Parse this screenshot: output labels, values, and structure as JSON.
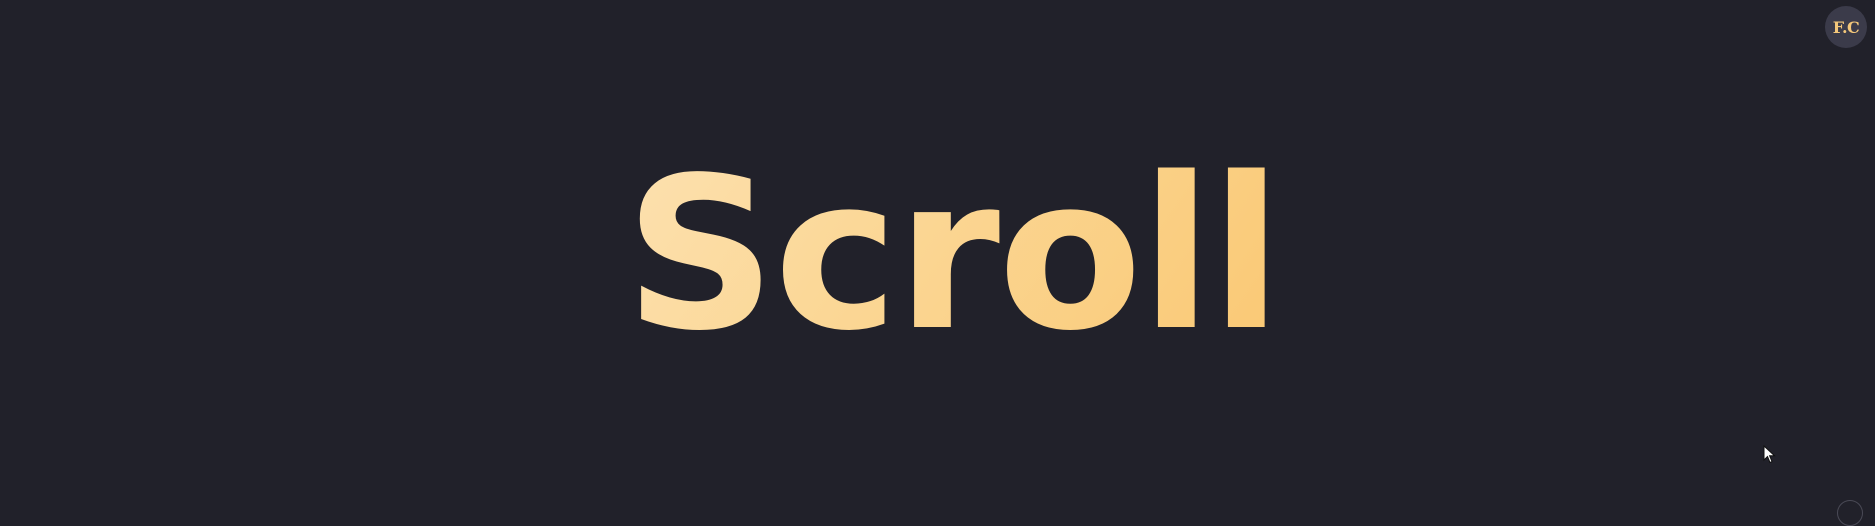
{
  "hero": {
    "title": "Scroll"
  },
  "avatar": {
    "initials": "F.C"
  },
  "colors": {
    "background": "#21212a",
    "gradient_start": "#fff4e4",
    "gradient_mid": "#fbd898",
    "gradient_end": "#f9b64a",
    "avatar_bg": "#3b3b4a",
    "avatar_text": "#f3c77a"
  },
  "icons": {
    "cursor": "mouse-pointer-icon",
    "corner": "scroll-indicator-icon"
  }
}
